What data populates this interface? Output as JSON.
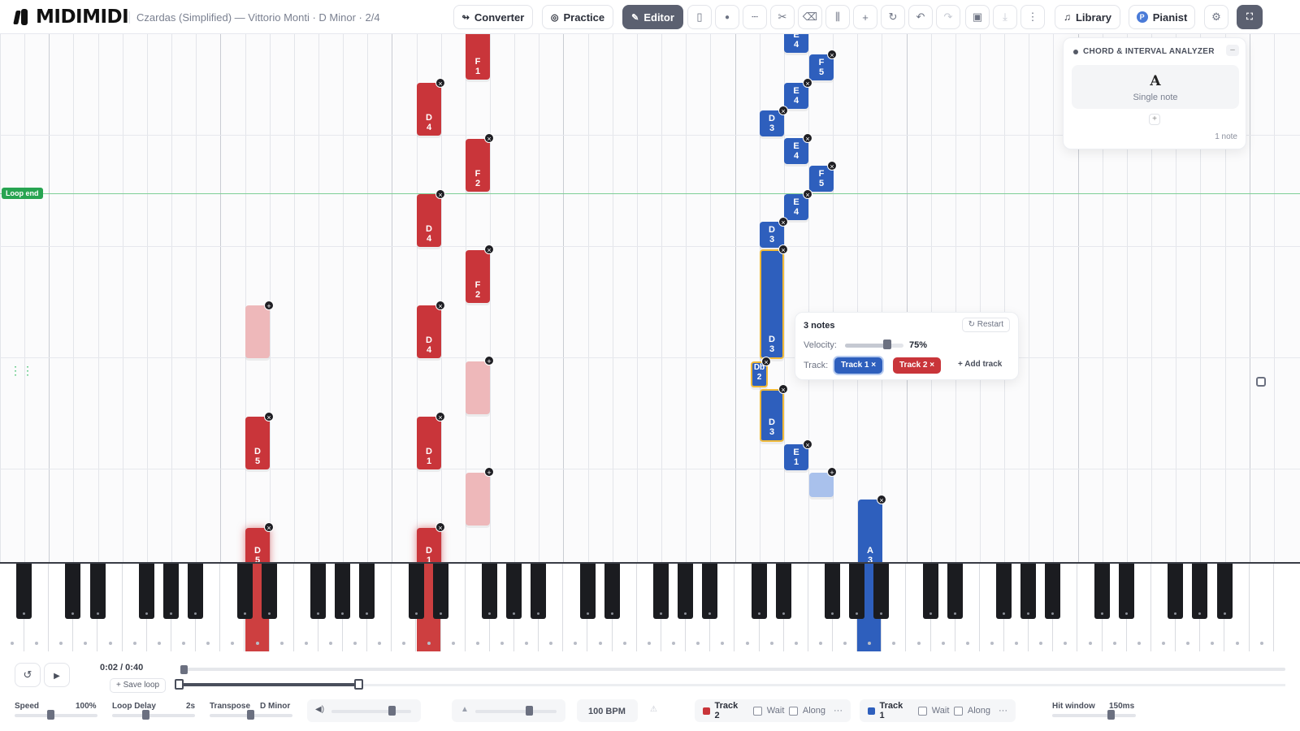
{
  "app": {
    "name": "MIDIMIDI",
    "song_title": "Czardas (Simplified) — Vittorio Monti · D Minor · 2/4"
  },
  "toolbar": {
    "converter": "Converter",
    "practice": "Practice",
    "editor": "Editor",
    "library": "Library",
    "pianist": "Pianist",
    "pianist_initial": "P"
  },
  "roll": {
    "loop_end_label": "Loop end"
  },
  "analyzer": {
    "title": "CHORD & INTERVAL ANALYZER",
    "chord_name": "A",
    "chord_desc": "Single note",
    "note_count": "1 note"
  },
  "note_popup": {
    "title": "3 notes",
    "restart": "Restart",
    "velocity_label": "Velocity:",
    "velocity_value": "75%",
    "velocity": 0.75,
    "track_label": "Track:",
    "track1": "Track 1 ×",
    "track2": "Track 2 ×",
    "add_track": "+ Add track"
  },
  "transport": {
    "time": "0:02 / 0:40",
    "save_loop": "+ Save loop",
    "speed_label": "Speed",
    "speed_value": "100%",
    "loop_delay_label": "Loop Delay",
    "loop_delay_value": "2s",
    "transpose_label": "Transpose",
    "transpose_value": "D Minor",
    "bpm": "100 BPM",
    "track2": {
      "name": "Track 2",
      "wait": "Wait",
      "along": "Along",
      "color": "#c9353a"
    },
    "track1": {
      "name": "Track 1",
      "wait": "Wait",
      "along": "Along",
      "color": "#2e5fbd"
    },
    "hit_window_label": "Hit window",
    "hit_window_value": "150ms"
  },
  "notes": [
    {
      "l1": "F",
      "l2": "1",
      "color": "red"
    },
    {
      "l1": "D",
      "l2": "4",
      "color": "red"
    },
    {
      "l1": "F",
      "l2": "2",
      "color": "red"
    },
    {
      "l1": "D",
      "l2": "4",
      "color": "red"
    },
    {
      "l1": "F",
      "l2": "2",
      "color": "red"
    },
    {
      "l1": "D",
      "l2": "4",
      "color": "red"
    },
    {
      "l1": "D",
      "l2": "5",
      "color": "red"
    },
    {
      "l1": "D",
      "l2": "1",
      "color": "red"
    },
    {
      "l1": "D",
      "l2": "5",
      "color": "red"
    },
    {
      "l1": "D",
      "l2": "1",
      "color": "red"
    },
    {
      "l1": "E",
      "l2": "4",
      "color": "blue"
    },
    {
      "l1": "F",
      "l2": "5",
      "color": "blue"
    },
    {
      "l1": "E",
      "l2": "4",
      "color": "blue"
    },
    {
      "l1": "D",
      "l2": "3",
      "color": "blue"
    },
    {
      "l1": "E",
      "l2": "4",
      "color": "blue"
    },
    {
      "l1": "F",
      "l2": "5",
      "color": "blue"
    },
    {
      "l1": "E",
      "l2": "4",
      "color": "blue"
    },
    {
      "l1": "D",
      "l2": "3",
      "color": "blue"
    },
    {
      "l1": "D",
      "l2": "3",
      "color": "blue"
    },
    {
      "l1": "Db",
      "l2": "2",
      "color": "blue"
    },
    {
      "l1": "D",
      "l2": "3",
      "color": "blue"
    },
    {
      "l1": "E",
      "l2": "1",
      "color": "blue"
    },
    {
      "l1": "A",
      "l2": "3",
      "color": "blue"
    }
  ]
}
